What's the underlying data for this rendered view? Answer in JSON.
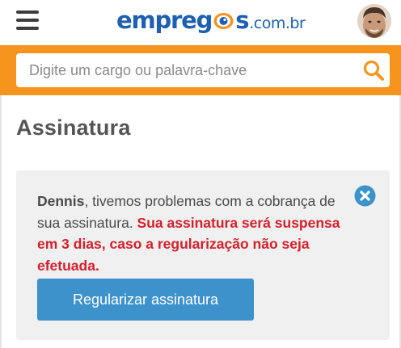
{
  "header": {
    "logo": {
      "part1": "empreg",
      "part2": "s",
      "tld": ".com.br"
    },
    "avatar_alt": "Dennis"
  },
  "search": {
    "placeholder": "Digite um cargo ou palavra-chave",
    "value": ""
  },
  "page": {
    "title": "Assinatura"
  },
  "alert": {
    "user_name": "Dennis",
    "message_normal": ", tivemos problemas com a cobrança de sua assinatura. ",
    "message_warning": "Sua assinatura será suspensa em 3 dias, caso a regularização não seja efetuada.",
    "button_label": "Regularizar assinatura"
  },
  "colors": {
    "brand_blue": "#1f5fb0",
    "search_bar_orange": "#f7941d",
    "button_blue": "#3d92cc",
    "warning_red": "#d4202c",
    "card_bg": "#f0f0f0"
  },
  "icons": {
    "menu": "hamburger-menu-icon",
    "logo_eye": "eye-icon",
    "search": "magnifier-icon",
    "close": "close-circle-icon"
  }
}
